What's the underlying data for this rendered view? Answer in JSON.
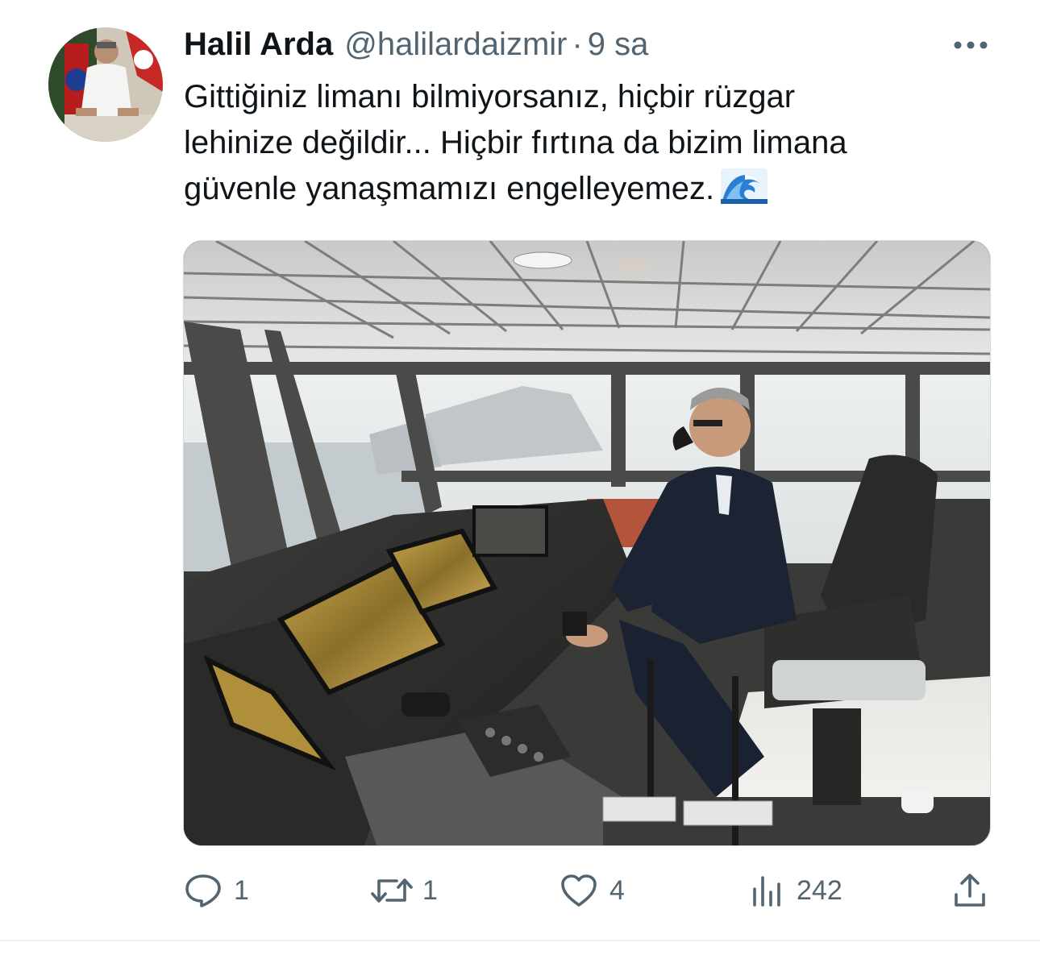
{
  "tweet": {
    "author": {
      "display_name": "Halil Arda",
      "handle": "@halilardaizmir",
      "separator": "·",
      "time": "9 sa"
    },
    "text": "Gittiğiniz limanı bilmiyorsanız, hiçbir rüzgar\nlehinize değildir... Hiçbir fırtına da bizim limana\ngüvenle yanaşmamızı engelleyemez.",
    "emoji": "water-wave-emoji",
    "media": {
      "description_icon": "photo-ship-bridge"
    },
    "actions": {
      "replies": "1",
      "retweets": "1",
      "likes": "4",
      "views": "242"
    }
  },
  "colors": {
    "text_primary": "#0f1419",
    "text_secondary": "#536471",
    "divider": "#eff3f4"
  },
  "icons": {
    "more": "more-horizontal-icon",
    "reply": "reply-icon",
    "retweet": "retweet-icon",
    "like": "heart-icon",
    "views": "views-chart-icon",
    "share": "share-icon"
  }
}
